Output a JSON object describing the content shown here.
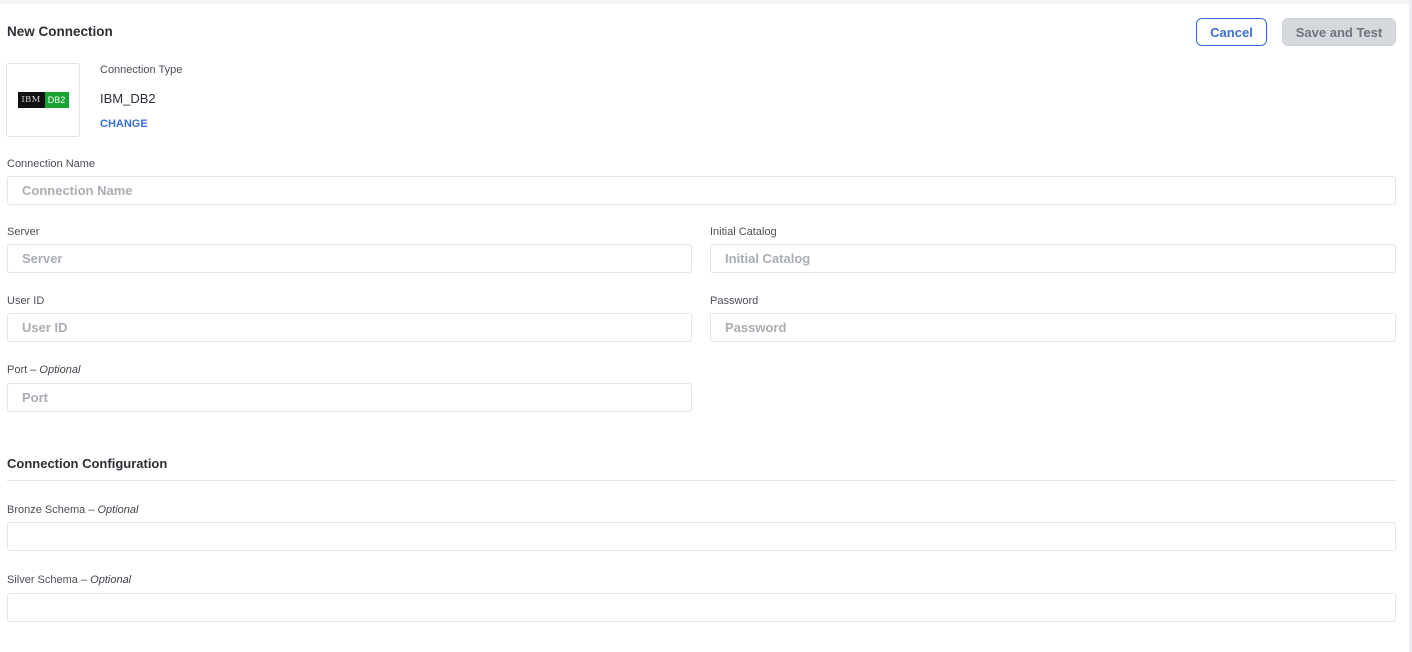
{
  "header": {
    "title": "New Connection",
    "cancel_label": "Cancel",
    "save_label": "Save and Test"
  },
  "connection_type": {
    "label": "Connection Type",
    "value": "IBM_DB2",
    "change_label": "CHANGE",
    "logo": {
      "left_text": "IBM",
      "right_text": "DB2",
      "left_bg": "#111111",
      "right_bg": "#1aa331"
    }
  },
  "fields": {
    "connection_name": {
      "label": "Connection Name",
      "placeholder": "Connection Name",
      "value": ""
    },
    "server": {
      "label": "Server",
      "placeholder": "Server",
      "value": ""
    },
    "initial_catalog": {
      "label": "Initial Catalog",
      "placeholder": "Initial Catalog",
      "value": ""
    },
    "user_id": {
      "label": "User ID",
      "placeholder": "User ID",
      "value": ""
    },
    "password": {
      "label": "Password",
      "placeholder": "Password",
      "value": ""
    },
    "port": {
      "label": "Port",
      "optional": "– Optional",
      "placeholder": "Port",
      "value": ""
    }
  },
  "configuration": {
    "title": "Connection Configuration",
    "bronze_schema": {
      "label": "Bronze Schema",
      "optional": "– Optional",
      "value": ""
    },
    "silver_schema": {
      "label": "Silver Schema",
      "optional": "– Optional",
      "value": ""
    }
  },
  "colors": {
    "accent": "#3a6fd1",
    "disabled_button": "#d5d8dd"
  }
}
